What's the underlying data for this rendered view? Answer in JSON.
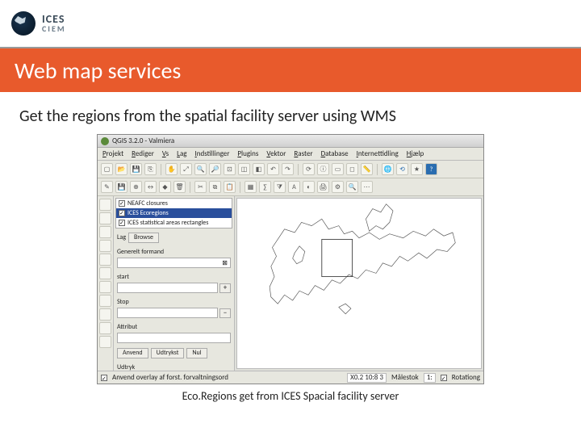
{
  "logo": {
    "line1": "ICES",
    "line2": "CIEM"
  },
  "slide_title": "Web map services",
  "intro_text": "Get the regions from the spatial facility server using WMS",
  "caption": "Eco.Regions get from ICES Spacial facility server",
  "qgis": {
    "title": "QGIS 3.2.0 - Valmiera",
    "menu": [
      "Projekt",
      "Rediger",
      "Vs",
      "Lag",
      "Indstillinger",
      "Plugins",
      "Vektor",
      "Raster",
      "Database",
      "Internettidling",
      "Hjælp"
    ],
    "layers": [
      {
        "label": "NEAFC closures",
        "checked": true,
        "selected": false
      },
      {
        "label": "ICES Ecoregions",
        "checked": true,
        "selected": true
      },
      {
        "label": "ICES statistical areas rectangles",
        "checked": true,
        "selected": false
      }
    ],
    "panel": {
      "lag_label": "Lag",
      "lag_value": "Browse",
      "general_label": "Generelt formand",
      "start_label": "start",
      "stop_label": "Stop",
      "attribut_label": "Attribut",
      "anvend": "Anvend",
      "udtryk_label": "Udtryk",
      "udtryk_value": "Udtrykst",
      "nul_btn": "Nul"
    },
    "status": {
      "left_text": "Anvend overlay af forst. forvaltningsord",
      "coords": "X0.2  10:8 3",
      "scale_label": "Målestok",
      "scale_value": "1:",
      "rotation_label": "Rotationg"
    }
  }
}
